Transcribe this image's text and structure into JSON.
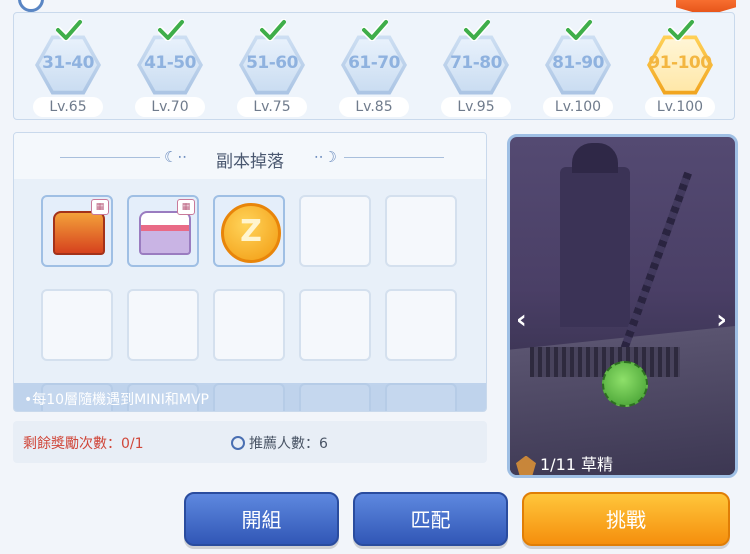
{
  "floors": [
    {
      "range": "31-40",
      "level": "Lv.65",
      "completed": true,
      "highlight": false
    },
    {
      "range": "41-50",
      "level": "Lv.70",
      "completed": true,
      "highlight": false
    },
    {
      "range": "51-60",
      "level": "Lv.75",
      "completed": true,
      "highlight": false
    },
    {
      "range": "61-70",
      "level": "Lv.85",
      "completed": true,
      "highlight": false
    },
    {
      "range": "71-80",
      "level": "Lv.95",
      "completed": true,
      "highlight": false
    },
    {
      "range": "81-90",
      "level": "Lv.100",
      "completed": true,
      "highlight": false
    },
    {
      "range": "91-100",
      "level": "Lv.100",
      "completed": true,
      "highlight": true
    }
  ],
  "drops": {
    "title": "副本掉落",
    "items": [
      {
        "icon": "red-treasure-chest-icon",
        "color": "#e25a2a"
      },
      {
        "icon": "purple-treasure-chest-icon",
        "color": "#b59ad6"
      },
      {
        "icon": "zeny-coin-icon",
        "label": "Z"
      }
    ],
    "note": "•每10層隨機遇到MINI和MVP"
  },
  "info": {
    "remaining_rewards": "剩餘獎勵次數：0/1",
    "recommended_players": "推薦人數：6"
  },
  "preview": {
    "caption": "1/11 草精",
    "prev_arrow": "‹",
    "next_arrow": "›"
  },
  "buttons": {
    "form_party": "開組",
    "match": "匹配",
    "challenge": "挑戰"
  },
  "colors": {
    "accent_blue": "#3157b6",
    "accent_orange": "#f58f0d",
    "warning_red": "#d0473a"
  }
}
